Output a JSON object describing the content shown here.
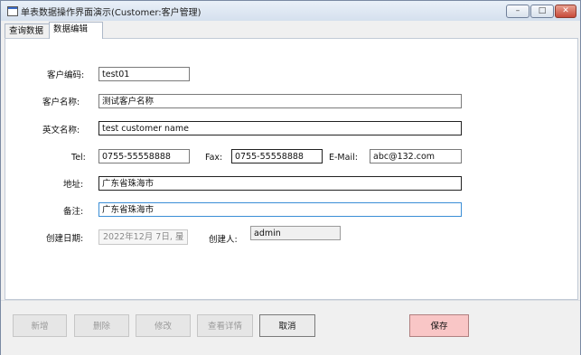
{
  "window": {
    "title": "单表数据操作界面演示(Customer:客户管理)",
    "controls": {
      "minimize": "–",
      "maximize": "□",
      "close": "✕"
    }
  },
  "tabs": [
    {
      "label": "查询数据",
      "selected": false
    },
    {
      "label": "数据编辑",
      "selected": true
    }
  ],
  "form": {
    "code_label": "客户编码:",
    "code_value": "test01",
    "name_label": "客户名称:",
    "name_value": "测试客户名称",
    "en_name_label": "英文名称:",
    "en_name_value": "test customer name",
    "tel_label": "Tel:",
    "tel_value": "0755-55558888",
    "fax_label": "Fax:",
    "fax_value": "0755-55558888",
    "email_label": "E-Mail:",
    "email_value": "abc@132.com",
    "address_label": "地址:",
    "address_value": "广东省珠海市",
    "remark_label": "备注:",
    "remark_value": "广东省珠海市",
    "created_date_label": "创建日期:",
    "created_date_value": "2022年12月  7日, 星",
    "creator_label": "创建人:",
    "creator_value": "admin"
  },
  "buttons": {
    "add": "新增",
    "delete": "删除",
    "edit": "修改",
    "view_detail": "查看详情",
    "cancel": "取消",
    "save": "保存"
  },
  "colors": {
    "save_button_bg": "#f9c6c6",
    "focus_border": "#3b8ed6"
  }
}
